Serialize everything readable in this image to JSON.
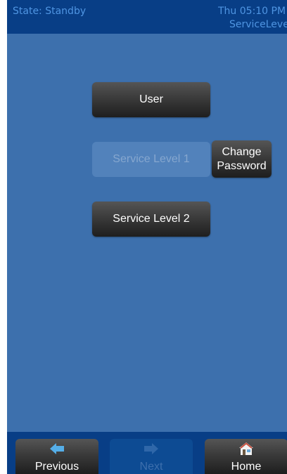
{
  "status_bar": {
    "state": "State: Standby",
    "clock": "Thu 05:10 PM",
    "level": "ServiceLevel"
  },
  "menu": {
    "user_label": "User",
    "service_level_1_label": "Service Level 1",
    "change_password_line1": "Change",
    "change_password_line2": "Password",
    "service_level_2_label": "Service Level 2"
  },
  "nav": {
    "previous_label": "Previous",
    "next_label": "Next",
    "home_label": "Home",
    "previous_icon": "arrow-left-icon",
    "next_icon": "arrow-right-icon",
    "home_icon": "home-icon"
  },
  "colors": {
    "header_bg": "#083e86",
    "header_text": "#4f95e2",
    "panel_bg": "#3d70ad",
    "button_dark": "#3b3b3b",
    "button_disabled": "#5282bb",
    "arrow_blue": "#55aee8"
  }
}
